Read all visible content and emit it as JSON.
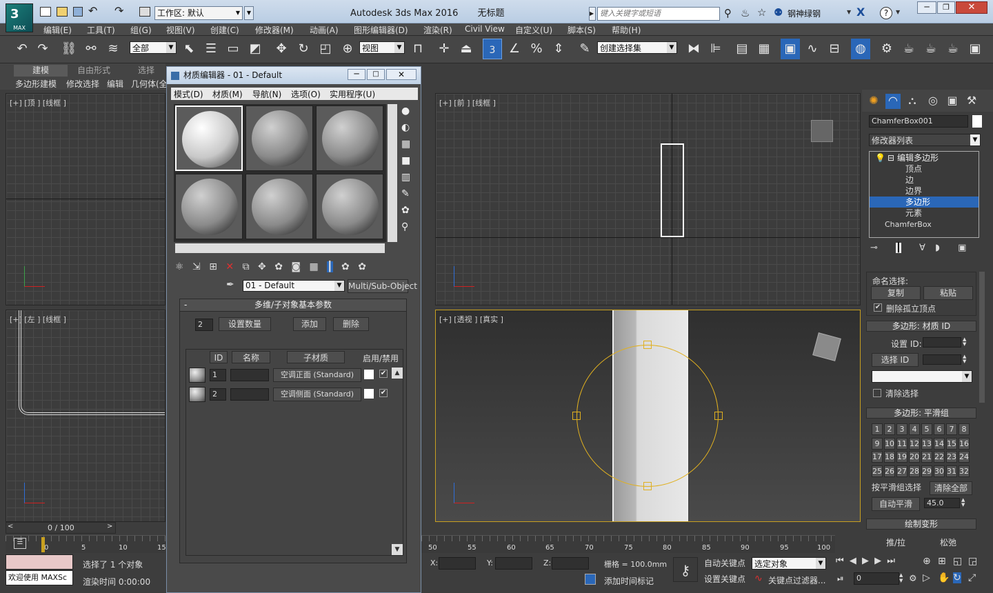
{
  "window": {
    "app_title": "Autodesk 3ds Max 2016",
    "doc_title": "无标题",
    "workspace": "工作区: 默认",
    "search_placeholder": "键入关键字或短语",
    "user": "钢神绿钢",
    "logo_text": "MAX"
  },
  "menu": [
    "编辑(E)",
    "工具(T)",
    "组(G)",
    "视图(V)",
    "创建(C)",
    "修改器(M)",
    "动画(A)",
    "图形编辑器(D)",
    "渲染(R)",
    "Civil View",
    "自定义(U)",
    "脚本(S)",
    "帮助(H)"
  ],
  "toolbar": {
    "filter": "全部",
    "ref_coord": "视图",
    "selection_set": "创建选择集",
    "snap_number": "3"
  },
  "ribbon": {
    "tabs": [
      "建模",
      "自由形式",
      "选择"
    ],
    "subtabs": [
      "多边形建模",
      "修改选择",
      "编辑",
      "几何体(全"
    ]
  },
  "viewports": {
    "top": "[+] [顶 ] [线框 ]",
    "front": "[+] [前 ] [线框 ]",
    "left": "[+] [左 ] [线框 ]",
    "persp": "[+] [透视 ] [真实 ]"
  },
  "material_editor": {
    "title": "材质编辑器 - 01 - Default",
    "menu": [
      "模式(D)",
      "材质(M)",
      "导航(N)",
      "选项(O)",
      "实用程序(U)"
    ],
    "material_name": "01 - Default",
    "material_type": "Multi/Sub-Object",
    "rollout": "多维/子对象基本参数",
    "count": "2",
    "set_count": "设置数量",
    "add": "添加",
    "delete": "删除",
    "headers": {
      "id": "ID",
      "name": "名称",
      "sub": "子材质",
      "toggle": "启用/禁用"
    },
    "rows": [
      {
        "id": "1",
        "name": "",
        "sub": "空调正面 (Standard)"
      },
      {
        "id": "2",
        "name": "",
        "sub": "空调侧面 (Standard)"
      }
    ]
  },
  "modify_panel": {
    "object_name": "ChamferBox001",
    "modifier_list": "修改器列表",
    "stack": [
      "编辑多边形",
      "顶点",
      "边",
      "边界",
      "多边形",
      "元素",
      "ChamferBox"
    ],
    "named_sel": "命名选择:",
    "copy": "复制",
    "paste": "粘贴",
    "delete_iso": "删除孤立顶点",
    "mat_id_title": "多边形: 材质 ID",
    "set_id": "设置 ID:",
    "select_id": "选择 ID",
    "clear_sel": "清除选择",
    "smooth_title": "多边形: 平滑组",
    "smooth_groups": [
      "1",
      "2",
      "3",
      "4",
      "5",
      "6",
      "7",
      "8",
      "9",
      "10",
      "11",
      "12",
      "13",
      "14",
      "15",
      "16",
      "17",
      "18",
      "19",
      "20",
      "21",
      "22",
      "23",
      "24",
      "25",
      "26",
      "27",
      "28",
      "29",
      "30",
      "31",
      "32"
    ],
    "select_by_sg": "按平滑组选择",
    "clear_all": "清除全部",
    "auto_smooth": "自动平滑",
    "auto_smooth_val": "45.0",
    "paint_deform": "绘制变形",
    "push_pull": "推/拉",
    "relax": "松弛"
  },
  "timeline": {
    "frame": "0 / 100",
    "ticks_left": [
      "0",
      "5",
      "10",
      "15"
    ],
    "ticks_right": [
      "50",
      "55",
      "60",
      "65",
      "70",
      "75",
      "80",
      "85",
      "90",
      "95",
      "100"
    ]
  },
  "status": {
    "welcome": "欢迎使用 MAXSc",
    "selected": "选择了 1 个对象",
    "render_time": "渲染时间 0:00:00",
    "x": "X:",
    "y": "Y:",
    "z": "Z:",
    "grid": "栅格 = 100.0mm",
    "add_tag": "添加时间标记",
    "auto_key": "自动关键点",
    "set_key": "设置关键点",
    "sel_obj": "选定对象",
    "key_filter": "关键点过滤器...",
    "frame_field": "0"
  }
}
